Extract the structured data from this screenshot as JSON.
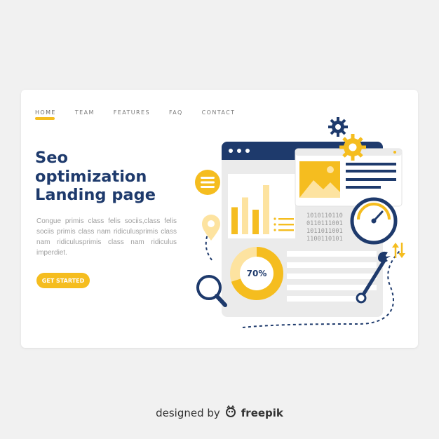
{
  "nav": {
    "items": [
      {
        "label": "HOME"
      },
      {
        "label": "TEAM"
      },
      {
        "label": "FEATURES"
      },
      {
        "label": "FAQ"
      },
      {
        "label": "CONTACT"
      }
    ]
  },
  "hero": {
    "title_lines": [
      "Seo",
      "optimization",
      "Landing page"
    ],
    "body": "Congue primis class felis sociis,class felis sociis primis class nam ridiculusprimis class nam ridiculusprimis class nam ridiculus imperdiet.",
    "cta_label": "GET STARTED"
  },
  "illustration": {
    "gauge_percent": "70%",
    "gauge_value": 0.7,
    "binary_lines": [
      "1010110110",
      "0110111001",
      "1011011001",
      "1100110101"
    ],
    "bar_values": [
      0.55,
      0.75,
      0.5,
      1.0
    ],
    "icons": [
      "gear-icon",
      "menu-icon",
      "location-pin-icon",
      "magnifier-icon",
      "wrench-icon",
      "speedometer-icon",
      "image-icon",
      "sort-arrows-icon"
    ]
  },
  "footer": {
    "designed_by": "designed by",
    "brand": "freepik"
  },
  "colors": {
    "navy": "#1e3a6c",
    "yellow": "#f5bd1f",
    "light_yellow": "#fde3a0",
    "gray_panel": "#ebebeb"
  }
}
